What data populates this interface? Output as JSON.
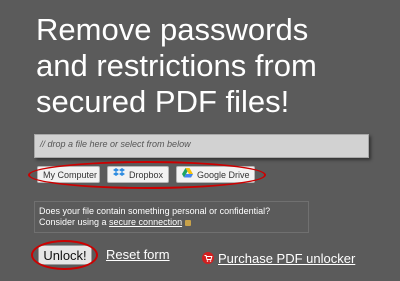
{
  "headline": {
    "line1": "Remove passwords",
    "line2": "and restrictions from",
    "line3": "secured PDF files!"
  },
  "dropzone": {
    "placeholder": "// drop a file here or select from below"
  },
  "sources": {
    "my_computer": "My Computer",
    "dropbox": "Dropbox",
    "google_drive": "Google Drive"
  },
  "notice": {
    "line1": "Does your file contain something personal or confidential?",
    "line2_prefix": "Consider using a ",
    "secure_link": "secure connection"
  },
  "actions": {
    "unlock": "Unlock!",
    "reset": "Reset form",
    "purchase": "Purchase PDF unlocker"
  },
  "colors": {
    "background": "#5b5b5b",
    "highlight_oval": "#cc0000",
    "cart_icon": "#d11f1f"
  },
  "icons": [
    "dropbox-icon",
    "google-drive-icon",
    "lock-icon",
    "cart-icon"
  ]
}
